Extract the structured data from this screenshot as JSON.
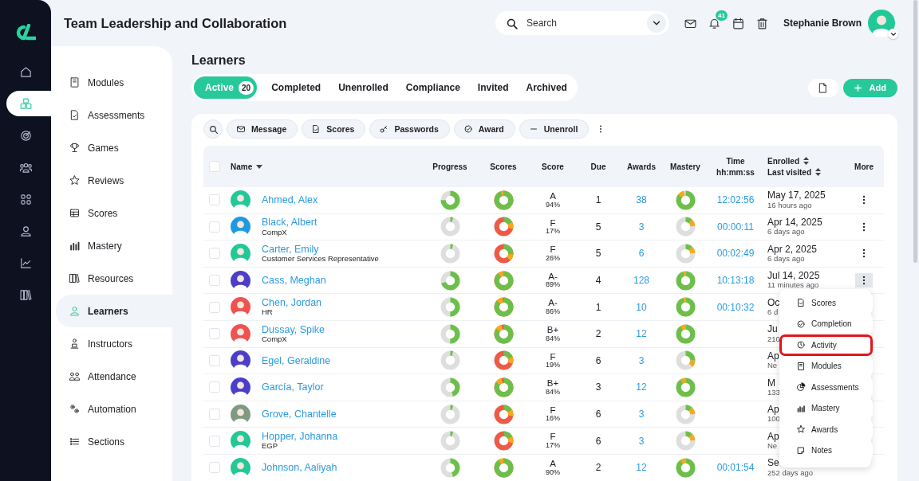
{
  "header": {
    "title": "Team Leadership and Collaboration",
    "search": {
      "placeholder": "Search"
    },
    "notification_count": "41",
    "user_name": "Stephanie Brown"
  },
  "rail": {
    "items": [
      {
        "selected": false
      },
      {
        "selected": true
      },
      {
        "selected": false
      },
      {
        "selected": false
      },
      {
        "selected": false
      },
      {
        "selected": false
      },
      {
        "selected": false
      },
      {
        "selected": false
      }
    ]
  },
  "sidebar": {
    "items": [
      {
        "label": "Modules",
        "selected": false
      },
      {
        "label": "Assessments",
        "selected": false
      },
      {
        "label": "Games",
        "selected": false
      },
      {
        "label": "Reviews",
        "selected": false
      },
      {
        "label": "Scores",
        "selected": false
      },
      {
        "label": "Mastery",
        "selected": false
      },
      {
        "label": "Resources",
        "selected": false
      },
      {
        "label": "Learners",
        "selected": true
      },
      {
        "label": "Instructors",
        "selected": false
      },
      {
        "label": "Attendance",
        "selected": false
      },
      {
        "label": "Automation",
        "selected": false
      },
      {
        "label": "Sections",
        "selected": false
      }
    ]
  },
  "page_title": "Learners",
  "tabs": [
    {
      "label": "Active",
      "count": "20",
      "selected": true
    },
    {
      "label": "Completed",
      "selected": false
    },
    {
      "label": "Unenrolled",
      "selected": false
    },
    {
      "label": "Compliance",
      "selected": false
    },
    {
      "label": "Invited",
      "selected": false
    },
    {
      "label": "Archived",
      "selected": false
    }
  ],
  "add_button": "Add",
  "toolbar": {
    "buttons": [
      "Message",
      "Scores",
      "Passwords",
      "Award",
      "Unenroll"
    ]
  },
  "table": {
    "header": {
      "checked": false,
      "name": "Name",
      "progress": "Progress",
      "scores": "Scores",
      "score": "Score",
      "due": "Due",
      "awards": "Awards",
      "mastery": "Mastery",
      "time": "Time",
      "time_format": "hh:mm:ss",
      "enrolled": "Enrolled",
      "last_visited": "Last visited",
      "more": "More"
    },
    "rows": [
      {
        "checked": false,
        "name": "Ahmed, Alex",
        "color": "#22c997",
        "grade": "A",
        "percent": "94%",
        "due": "1",
        "awards": "38",
        "time": "12:02:56",
        "enrolled": "May 17, 2025",
        "last_visited": "16 hours ago",
        "menu_open": false
      },
      {
        "checked": false,
        "name": "Black, Albert",
        "subtitle": "CompX",
        "color": "#1e9be0",
        "grade": "F",
        "percent": "17%",
        "due": "5",
        "awards": "3",
        "time": "00:00:11",
        "enrolled": "Apr 14, 2025",
        "last_visited": "6 days ago",
        "menu_open": false
      },
      {
        "checked": false,
        "name": "Carter, Emily",
        "subtitle": "Customer Services Representative",
        "color": "#22c997",
        "grade": "F",
        "percent": "26%",
        "due": "5",
        "awards": "6",
        "time": "00:02:49",
        "enrolled": "Apr 2, 2025",
        "last_visited": "6 days ago",
        "menu_open": false
      },
      {
        "checked": false,
        "name": "Cass, Meghan",
        "color": "#4b3fc9",
        "grade": "A-",
        "percent": "89%",
        "due": "4",
        "awards": "128",
        "time": "10:13:18",
        "enrolled": "Jul 14, 2025",
        "last_visited": "11 minutes ago",
        "menu_open": true
      },
      {
        "checked": false,
        "name": "Chen, Jordan",
        "subtitle": "HR",
        "color": "#ef5350",
        "grade": "A-",
        "percent": "86%",
        "due": "1",
        "awards": "10",
        "time": "00:10:32",
        "enrolled": "Oc",
        "last_visited": "6 d"
      },
      {
        "checked": false,
        "name": "Dussay, Spike",
        "subtitle": "CompX",
        "color": "#ef5350",
        "grade": "B+",
        "percent": "84%",
        "due": "2",
        "awards": "12",
        "enrolled": "Ju",
        "last_visited": "210"
      },
      {
        "checked": false,
        "name": "Egel, Geraldine",
        "color": "#4b3fc9",
        "grade": "F",
        "percent": "19%",
        "due": "6",
        "awards": "3",
        "enrolled": "Ap",
        "last_visited": "Ne"
      },
      {
        "checked": false,
        "name": "García, Taylor",
        "color": "#4b3fc9",
        "grade": "B+",
        "percent": "84%",
        "due": "3",
        "awards": "12",
        "enrolled": "M",
        "last_visited": "133"
      },
      {
        "checked": false,
        "name": "Grove, Chantelle",
        "color": "#7f9a80",
        "grade": "F",
        "percent": "16%",
        "due": "6",
        "awards": "3",
        "enrolled": "Ap",
        "last_visited": "100"
      },
      {
        "checked": false,
        "name": "Hopper, Johanna",
        "subtitle": "EGP",
        "color": "#22c997",
        "grade": "F",
        "percent": "17%",
        "due": "6",
        "awards": "3",
        "enrolled": "Ap",
        "last_visited": "Ne"
      },
      {
        "checked": false,
        "name": "Johnson, Aaliyah",
        "color": "#22c997",
        "grade": "A",
        "percent": "90%",
        "due": "2",
        "awards": "12",
        "time": "00:01:54",
        "enrolled": "Se",
        "last_visited": "252 days ago"
      }
    ]
  },
  "menu": {
    "items": [
      {
        "label": "Scores",
        "highlighted": false
      },
      {
        "label": "Completion",
        "highlighted": false
      },
      {
        "label": "Activity",
        "highlighted": true
      },
      {
        "label": "Modules",
        "highlighted": false
      },
      {
        "label": "Assessments",
        "highlighted": false
      },
      {
        "label": "Mastery",
        "highlighted": false
      },
      {
        "label": "Awards",
        "highlighted": false
      },
      {
        "label": "Notes",
        "highlighted": false
      }
    ]
  }
}
